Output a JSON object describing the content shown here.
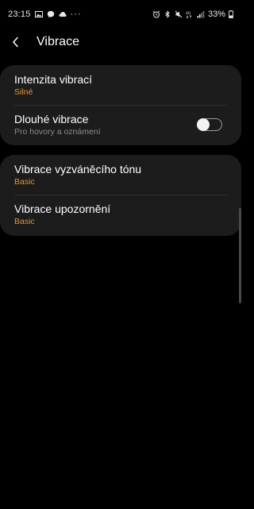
{
  "status_bar": {
    "time": "23:15",
    "left_icons": [
      "image-icon",
      "messenger-icon",
      "cloud-icon"
    ],
    "more": "···",
    "right_icons": [
      "alarm-icon",
      "bluetooth-icon",
      "mute-icon",
      "4g-icon",
      "signal-icon"
    ],
    "battery_percent": "33%"
  },
  "header": {
    "title": "Vibrace"
  },
  "sections": [
    {
      "items": [
        {
          "title": "Intenzita vibrací",
          "subtitle": "Silné"
        },
        {
          "title": "Dlouhé vibrace",
          "subtitle": "Pro hovory a oznámení",
          "toggle_on": false
        }
      ]
    },
    {
      "items": [
        {
          "title": "Vibrace vyzváněcího tónu",
          "subtitle": "Basic"
        },
        {
          "title": "Vibrace upozornění",
          "subtitle": "Basic"
        }
      ]
    }
  ],
  "colors": {
    "background": "#000000",
    "card": "#1c1c1c",
    "accent": "#e8932b",
    "secondary_text": "#8c8c8c"
  }
}
